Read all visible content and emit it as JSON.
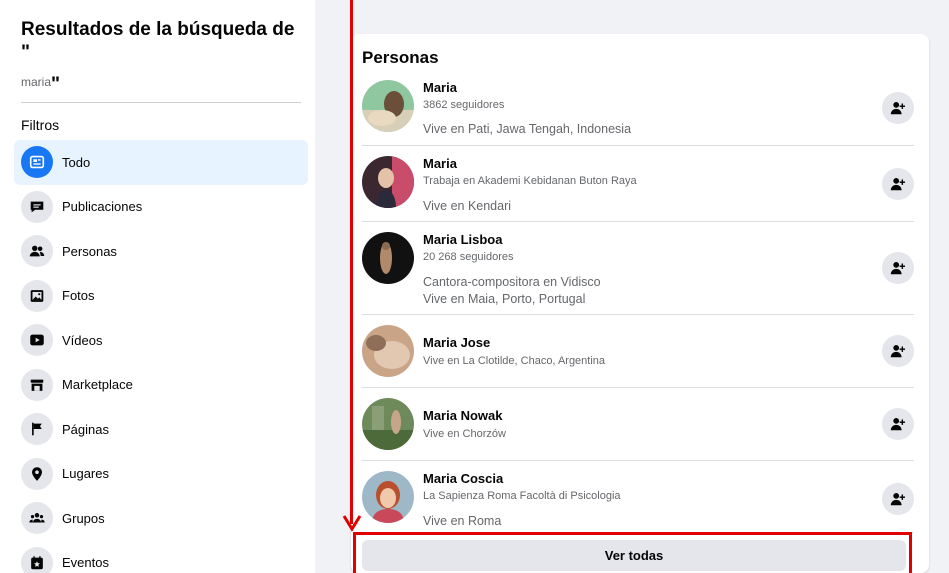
{
  "sidebar": {
    "title": "Resultados de la búsqueda de \"",
    "query": "maria",
    "query_close": "\"",
    "filters_heading": "Filtros",
    "items": [
      {
        "label": "Todo",
        "icon": "feed-icon",
        "active": true
      },
      {
        "label": "Publicaciones",
        "icon": "posts-icon",
        "active": false
      },
      {
        "label": "Personas",
        "icon": "people-icon",
        "active": false
      },
      {
        "label": "Fotos",
        "icon": "photos-icon",
        "active": false
      },
      {
        "label": "Vídeos",
        "icon": "video-icon",
        "active": false
      },
      {
        "label": "Marketplace",
        "icon": "marketplace-icon",
        "active": false
      },
      {
        "label": "Páginas",
        "icon": "flag-icon",
        "active": false
      },
      {
        "label": "Lugares",
        "icon": "location-pin-icon",
        "active": false
      },
      {
        "label": "Grupos",
        "icon": "groups-icon",
        "active": false
      },
      {
        "label": "Eventos",
        "icon": "events-icon",
        "active": false
      }
    ]
  },
  "main": {
    "section_title": "Personas",
    "people": [
      {
        "name": "Maria",
        "meta": "3862 seguidores",
        "desc": [
          "Vive en Pati, Jawa Tengah, Indonesia"
        ]
      },
      {
        "name": "Maria",
        "meta": "Trabaja en Akademi Kebidanan Buton Raya",
        "desc": [
          "Vive en Kendari"
        ]
      },
      {
        "name": "Maria Lisboa",
        "meta": "20 268 seguidores",
        "desc": [
          "Cantora-compositora en Vidisco",
          "Vive en Maia, Porto, Portugal"
        ]
      },
      {
        "name": "Maria Jose",
        "meta": "Vive en La Clotilde, Chaco, Argentina",
        "desc": []
      },
      {
        "name": "Maria Nowak",
        "meta": "Vive en Chorzów",
        "desc": []
      },
      {
        "name": "Maria Coscia",
        "meta": "La Sapienza Roma Facoltà di Psicologia",
        "desc": [
          "Vive en Roma"
        ]
      }
    ],
    "see_all_label": "Ver todas"
  },
  "colors": {
    "accent": "#1877f2",
    "annotation": "#e00000",
    "background": "#f0f2f5"
  }
}
